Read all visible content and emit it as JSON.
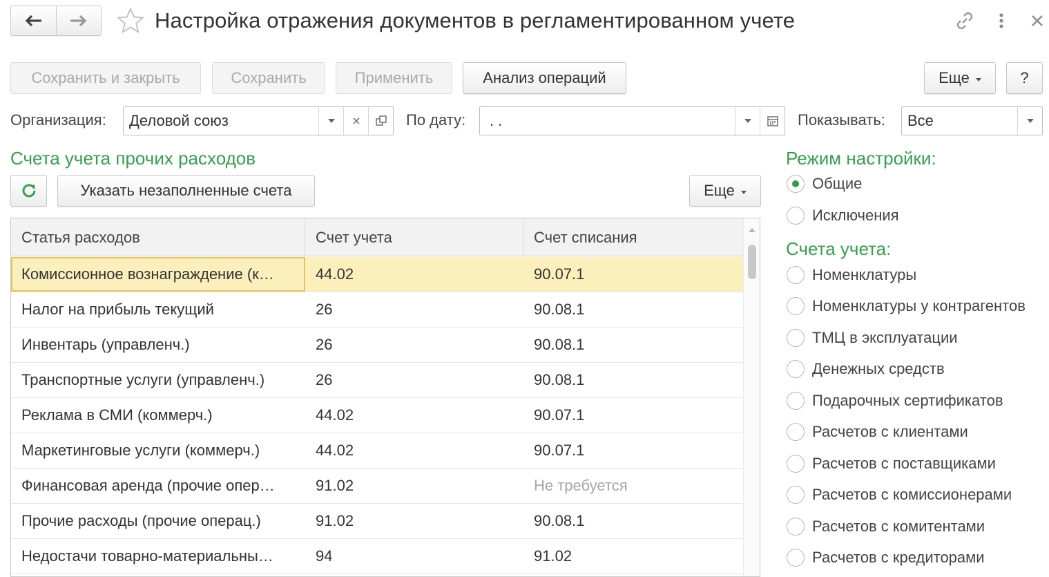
{
  "window": {
    "title": "Настройка отражения документов в регламентированном учете"
  },
  "toolbar": {
    "save_close": "Сохранить и закрыть",
    "save": "Сохранить",
    "apply": "Применить",
    "analysis": "Анализ операций",
    "more": "Еще",
    "help": "?"
  },
  "filters": {
    "org_label": "Организация:",
    "org_value": "Деловой союз",
    "date_label": "По дату:",
    "date_value": " .  .",
    "show_label": "Показывать:",
    "show_value": "Все"
  },
  "section": {
    "title": "Счета учета прочих расходов",
    "fill_button": "Указать незаполненные счета",
    "more": "Еще"
  },
  "table": {
    "columns": [
      "Статья расходов",
      "Счет учета",
      "Счет списания"
    ],
    "rows": [
      [
        "Комиссионное вознаграждение (к…",
        "44.02",
        "90.07.1"
      ],
      [
        "Налог на прибыль текущий",
        "26",
        "90.08.1"
      ],
      [
        "Инвентарь (управленч.)",
        "26",
        "90.08.1"
      ],
      [
        "Транспортные услуги (управленч.)",
        "26",
        "90.08.1"
      ],
      [
        "Реклама в СМИ (коммерч.)",
        "44.02",
        "90.07.1"
      ],
      [
        "Маркетинговые услуги (коммерч.)",
        "44.02",
        "90.07.1"
      ],
      [
        "Финансовая аренда (прочие опер…",
        "91.02",
        "Не требуется"
      ],
      [
        "Прочие расходы (прочие операц.)",
        "91.02",
        "90.08.1"
      ],
      [
        "Недостачи товарно-материальны…",
        "94",
        "91.02"
      ]
    ],
    "selected_row": 0
  },
  "mode": {
    "title": "Режим настройки:",
    "options": [
      "Общие",
      "Исключения"
    ],
    "selected": 0
  },
  "accounts": {
    "title": "Счета учета:",
    "options": [
      "Номенклатуры",
      "Номенклатуры у контрагентов",
      "ТМЦ в эксплуатации",
      "Денежных средств",
      "Подарочных сертификатов",
      "Расчетов с клиентами",
      "Расчетов с поставщиками",
      "Расчетов с комиссионерами",
      "Расчетов с комитентами",
      "Расчетов с кредиторами"
    ]
  },
  "colors": {
    "accent_green": "#34a04c",
    "selected_row": "#fbefbc",
    "selected_cell_border": "#e5c35f"
  },
  "icons": [
    "arrow-left-icon",
    "arrow-right-icon",
    "star-icon",
    "link-icon",
    "kebab-icon",
    "close-icon",
    "refresh-icon",
    "calendar-icon",
    "open-icon",
    "clear-icon",
    "dropdown-icon"
  ]
}
